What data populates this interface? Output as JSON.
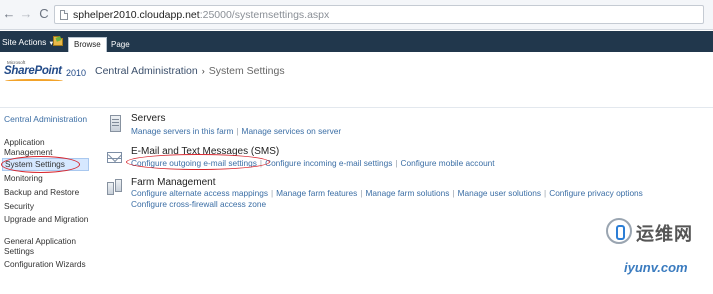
{
  "browser": {
    "url_host": "sphelper2010.cloudapp.net",
    "url_path": ":25000/systemsettings.aspx"
  },
  "ribbon": {
    "site_actions": "Site Actions",
    "tabs": [
      {
        "label": "Browse",
        "selected": true
      },
      {
        "label": "Page",
        "selected": false
      }
    ],
    "color": "#21374c"
  },
  "header": {
    "logo_prefix": "Microsoft",
    "logo_product": "SharePoint",
    "logo_version": "2010",
    "breadcrumb_root": "Central Administration",
    "breadcrumb_separator": "›",
    "breadcrumb_current": "System Settings"
  },
  "quicklaunch": {
    "items": [
      {
        "label": "Central Administration",
        "heading": true
      },
      {
        "label": "Application Management"
      },
      {
        "label": "System Settings",
        "selected": true
      },
      {
        "label": "Monitoring"
      },
      {
        "label": "Backup and Restore"
      },
      {
        "label": "Security"
      },
      {
        "label": "Upgrade and Migration"
      },
      {
        "label": "General Application Settings"
      },
      {
        "label": "Configuration Wizards"
      }
    ]
  },
  "groups": [
    {
      "icon": "server-icon",
      "title": "Servers",
      "links": [
        "Manage servers in this farm",
        "Manage services on server"
      ]
    },
    {
      "icon": "mail-icon",
      "title": "E-Mail and Text Messages (SMS)",
      "links": [
        "Configure outgoing e-mail settings",
        "Configure incoming e-mail settings",
        "Configure mobile account"
      ]
    },
    {
      "icon": "farm-icon",
      "title": "Farm Management",
      "links": [
        "Configure alternate access mappings",
        "Manage farm features",
        "Manage farm solutions",
        "Manage user solutions",
        "Configure privacy options"
      ],
      "links_line2": [
        "Configure cross-firewall access zone"
      ]
    }
  ],
  "watermark": {
    "cn_text": "运维网",
    "url_text": "iyunv.com"
  },
  "colors": {
    "link": "#3b6ea5",
    "annotation": "#d8262e",
    "selected_bg": "#d6e8ff"
  }
}
